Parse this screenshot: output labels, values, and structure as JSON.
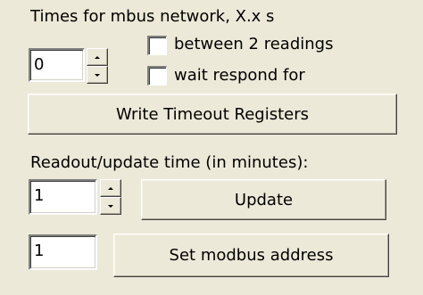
{
  "timeout_section": {
    "heading": "Times for mbus network, X.x s",
    "value": "0",
    "checkbox_between_label": "between 2 readings",
    "checkbox_between_checked": false,
    "checkbox_wait_label": "wait respond for",
    "checkbox_wait_checked": false,
    "write_button_label": "Write Timeout Registers"
  },
  "readout_section": {
    "heading": "Readout/update time (in minutes):",
    "value": "1",
    "update_button_label": "Update"
  },
  "modbus_section": {
    "address_value": "1",
    "set_address_button_label": "Set modbus address"
  }
}
